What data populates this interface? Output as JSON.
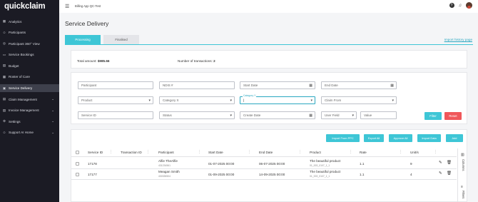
{
  "app": {
    "logo": "quickclaim",
    "environment": "Billing App QC-Test"
  },
  "sidebar": {
    "items": [
      {
        "label": "Analytics",
        "icon": "▦",
        "active": false,
        "chevron": false
      },
      {
        "label": "Participants",
        "icon": "☺",
        "active": false,
        "chevron": false
      },
      {
        "label": "Participant 360° View",
        "icon": "◎",
        "active": false,
        "chevron": false
      },
      {
        "label": "Service Bookings",
        "icon": "▭",
        "active": false,
        "chevron": false
      },
      {
        "label": "Budget",
        "icon": "▤",
        "active": false,
        "chevron": false
      },
      {
        "label": "Roster of Care",
        "icon": "▦",
        "active": false,
        "chevron": false
      },
      {
        "label": "Service Delivery",
        "icon": "▣",
        "active": true,
        "chevron": false
      },
      {
        "label": "Claim Management",
        "icon": "▤",
        "active": false,
        "chevron": true
      },
      {
        "label": "Invoice Management",
        "icon": "▤",
        "active": false,
        "chevron": true
      },
      {
        "label": "Settings",
        "icon": "⚙",
        "active": false,
        "chevron": true
      },
      {
        "label": "Support AI Home",
        "icon": "☺",
        "active": false,
        "chevron": true
      }
    ]
  },
  "topbar": {
    "help_icon": "?",
    "bell_icon": "🔔"
  },
  "page": {
    "title": "Service Delivery",
    "tabs": [
      {
        "label": "Processing",
        "active": true
      },
      {
        "label": "Finalised",
        "active": false
      }
    ],
    "import_history_link": "Import history page"
  },
  "summary": {
    "total_label": "Total amount:",
    "total_value": "$985.66",
    "tx_label": "Number of transactions:",
    "tx_value": "2"
  },
  "filters": {
    "participant": "Participant",
    "ndis": "NDIS #",
    "start_date": "Start Date",
    "end_date": "End Date",
    "product": "Product",
    "category": "Category X",
    "category_y_label": "Category Y",
    "category_y_value": "|",
    "claim_from": "Claim From",
    "service_id": "Service ID",
    "status": "Status",
    "create_date": "Create Date",
    "user_field": "User Field",
    "value": "Value",
    "filter_btn": "Filter",
    "reset_btn": "Reset"
  },
  "toolbar": {
    "import_ppc": "Import From PPC",
    "export_all": "Export All",
    "approve_all": "Approve All",
    "import_data": "Import Data",
    "add": "Add"
  },
  "table": {
    "columns": [
      "Service ID",
      "Transaction ID",
      "Participant",
      "Start Date",
      "End Date",
      "Product",
      "Rate",
      "Unit/s"
    ],
    "rows": [
      {
        "service_id": "17178",
        "transaction_id": "",
        "participant": "Alfie TheAlfie",
        "participant_sub": "431234561",
        "start_date": "01-07-2025 00:00",
        "end_date": "06-07-2025 00:00",
        "product": "The beautiful product",
        "product_sub": "01_003_0107_1_1",
        "rate": "1.1",
        "units": "9"
      },
      {
        "service_id": "17177",
        "transaction_id": "",
        "participant": "Meagan Smith",
        "participant_sub": "430335504",
        "start_date": "01-09-2025 00:00",
        "end_date": "14-09-2025 00:00",
        "product": "The beautiful product",
        "product_sub": "01_003_0107_1_1",
        "rate": "1.1",
        "units": "4"
      }
    ]
  },
  "side_panel": {
    "columns_label": "Columns",
    "filters_label": "Filters"
  }
}
